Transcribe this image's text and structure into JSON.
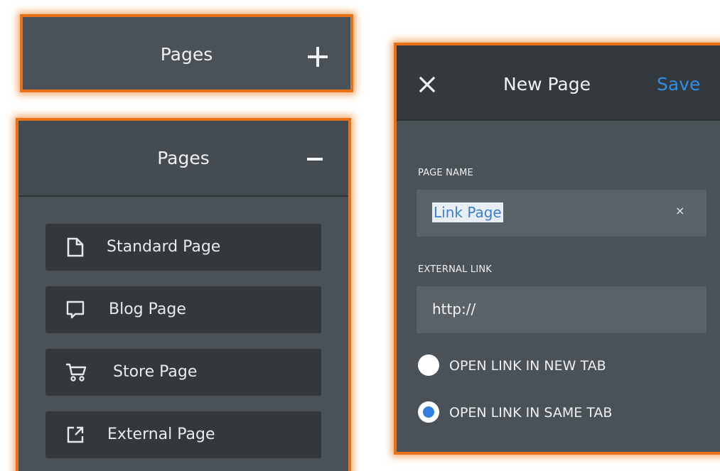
{
  "pages_collapsed": {
    "title": "Pages",
    "toggle_icon": "plus-icon"
  },
  "pages_expanded": {
    "title": "Pages",
    "toggle_icon": "minus-icon",
    "page_types": [
      {
        "label": "Standard Page",
        "icon": "document-icon"
      },
      {
        "label": "Blog Page",
        "icon": "speech-bubble-icon"
      },
      {
        "label": "Store Page",
        "icon": "cart-icon"
      },
      {
        "label": "External Page",
        "icon": "external-link-icon"
      }
    ]
  },
  "new_page": {
    "title": "New Page",
    "close_icon": "close-icon",
    "save_label": "Save",
    "page_name": {
      "label": "PAGE NAME",
      "value": "Link Page",
      "clear_symbol": "×"
    },
    "external_link": {
      "label": "EXTERNAL LINK",
      "value": "http://"
    },
    "options": [
      {
        "label": "OPEN LINK IN NEW TAB",
        "checked": false
      },
      {
        "label": "OPEN LINK IN SAME TAB",
        "checked": true
      }
    ]
  },
  "colors": {
    "highlight_border": "#e8721c",
    "panel_bg": "#4a5258",
    "item_bg": "#33383c",
    "accent": "#2f8ee6"
  }
}
